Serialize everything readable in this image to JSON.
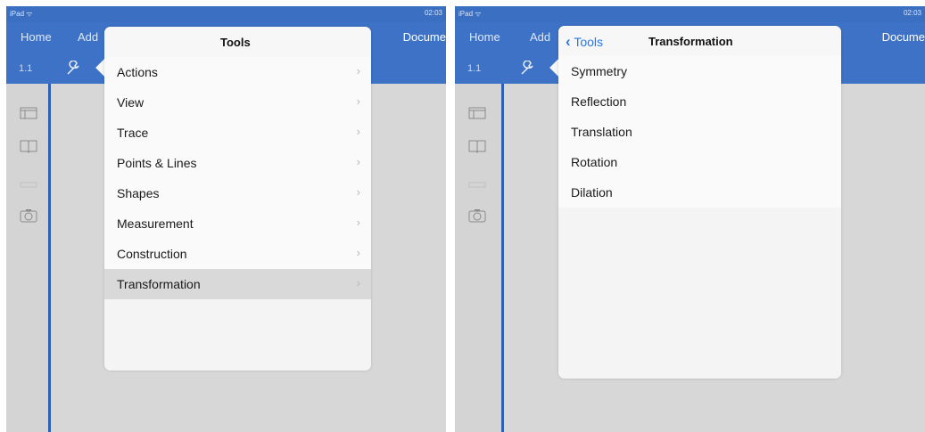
{
  "left": {
    "status": {
      "carrier": "iPad ᯤ",
      "time": "02:03"
    },
    "nav": {
      "home": "Home",
      "add": "Add",
      "documents": "Docume"
    },
    "toolbar": {
      "page": "1.1"
    },
    "popover": {
      "title": "Tools",
      "items": [
        {
          "label": "Actions"
        },
        {
          "label": "View"
        },
        {
          "label": "Trace"
        },
        {
          "label": "Points & Lines"
        },
        {
          "label": "Shapes"
        },
        {
          "label": "Measurement"
        },
        {
          "label": "Construction"
        },
        {
          "label": "Transformation",
          "selected": true
        }
      ]
    }
  },
  "right": {
    "status": {
      "carrier": "iPad ᯤ",
      "time": "02:03"
    },
    "nav": {
      "home": "Home",
      "add": "Add",
      "documents": "Docume"
    },
    "toolbar": {
      "page": "1.1"
    },
    "popover": {
      "back_label": "Tools",
      "title": "Transformation",
      "items": [
        {
          "label": "Symmetry"
        },
        {
          "label": "Reflection"
        },
        {
          "label": "Translation"
        },
        {
          "label": "Rotation"
        },
        {
          "label": "Dilation"
        }
      ]
    }
  },
  "icons": {
    "chevron": "›",
    "wrench": "🔧",
    "layout": "▭",
    "book": "🕮",
    "camera": "◎",
    "back": "‹"
  }
}
